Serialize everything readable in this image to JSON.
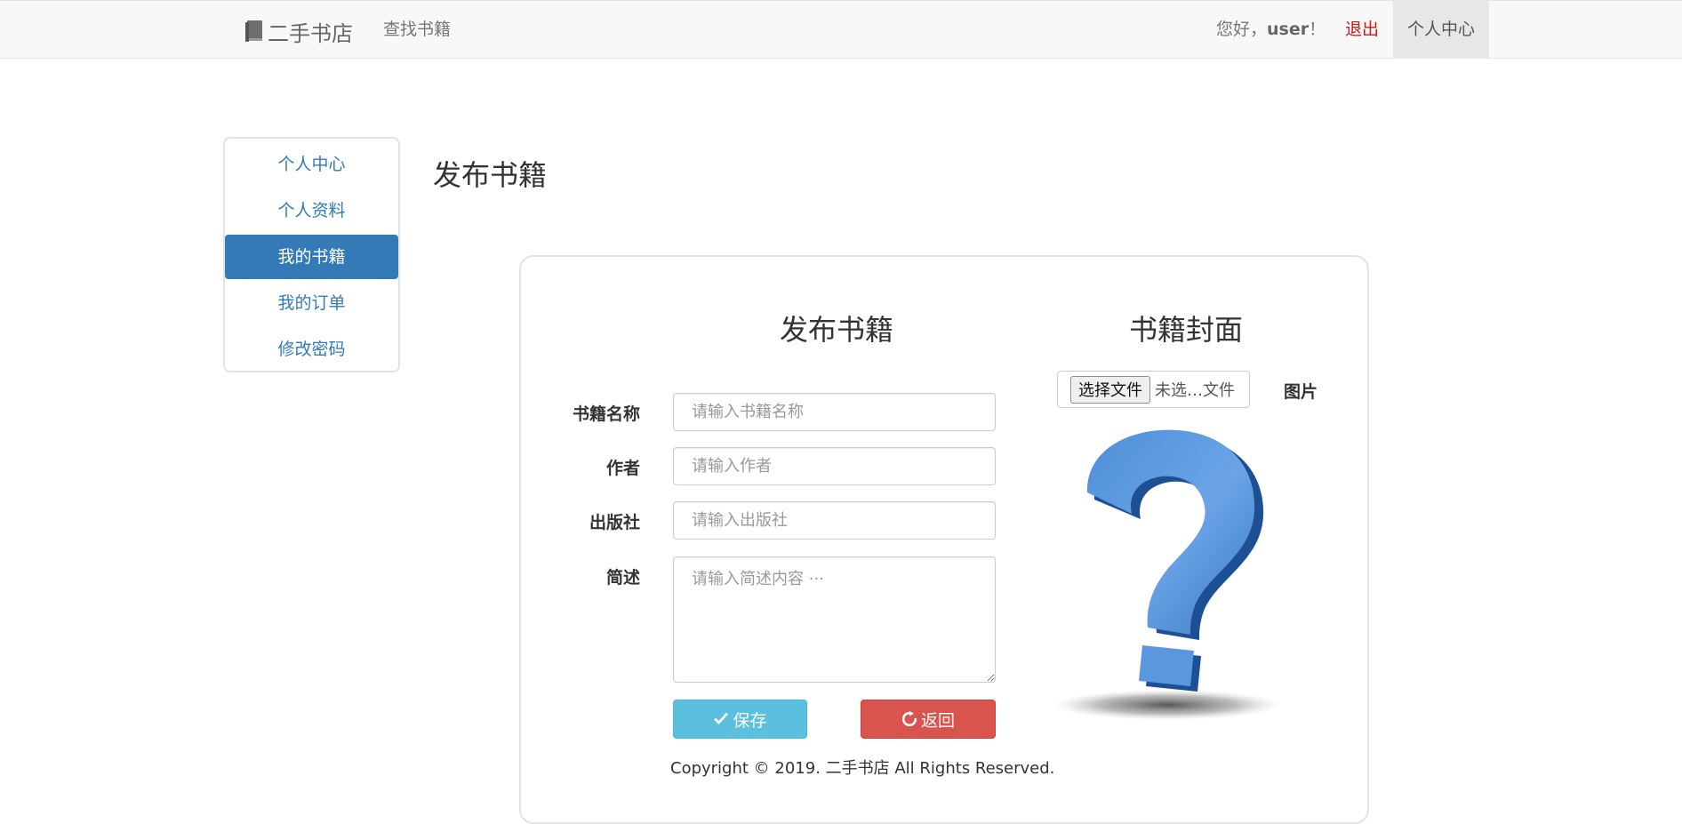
{
  "navbar": {
    "brand": "二手书店",
    "find_books": "查找书籍",
    "greeting_prefix": "您好，",
    "username": "user",
    "greeting_suffix": "！",
    "logout": "退出",
    "user_center": "个人中心"
  },
  "sidebar": {
    "items": [
      {
        "label": "个人中心"
      },
      {
        "label": "个人资料"
      },
      {
        "label": "我的书籍"
      },
      {
        "label": "我的订单"
      },
      {
        "label": "修改密码"
      }
    ],
    "active_index": 2
  },
  "page": {
    "title": "发布书籍"
  },
  "form": {
    "title": "发布书籍",
    "fields": {
      "name": {
        "label": "书籍名称",
        "placeholder": "请输入书籍名称",
        "value": ""
      },
      "author": {
        "label": "作者",
        "placeholder": "请输入作者",
        "value": ""
      },
      "publisher": {
        "label": "出版社",
        "placeholder": "请输入出版社",
        "value": ""
      },
      "summary": {
        "label": "简述",
        "placeholder": "请输入简述内容 ···",
        "value": ""
      }
    },
    "save_label": "保存",
    "back_label": "返回",
    "copyright": "Copyright © 2019. 二手书店 All Rights Reserved."
  },
  "cover": {
    "title": "书籍封面",
    "choose_file_label": "选择文件",
    "file_status": "未选…文件",
    "picture_label": "图片"
  },
  "colors": {
    "primary": "#337ab7",
    "info": "#5bc0de",
    "danger": "#d9534f",
    "logout": "#cc1a1a",
    "navbar_bg": "#f8f8f8"
  },
  "icons": {
    "brand": "book-icon",
    "save": "check-icon",
    "back": "refresh-icon",
    "cover_placeholder": "question-mark-icon"
  }
}
